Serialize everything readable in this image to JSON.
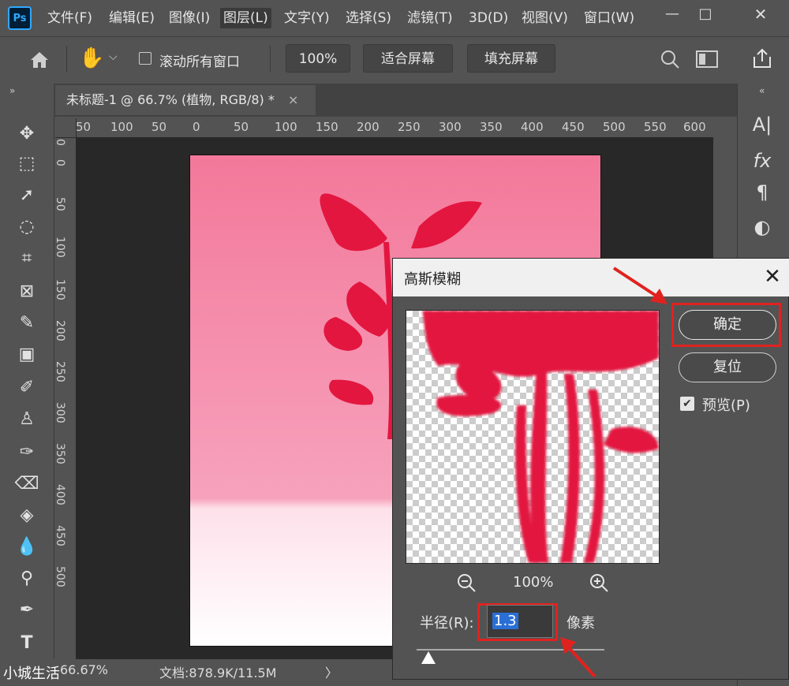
{
  "app": {
    "logo_text": "Ps"
  },
  "menu": [
    "文件(F)",
    "编辑(E)",
    "图像(I)",
    "图层(L)",
    "文字(Y)",
    "选择(S)",
    "滤镜(T)",
    "3D(D)",
    "视图(V)",
    "窗口(W)"
  ],
  "window_controls": {
    "minimize": "—",
    "maximize": "□",
    "close": "✕"
  },
  "options_bar": {
    "scroll_all_label": "滚动所有窗口",
    "zoom_value": "100%",
    "fit_screen_label": "适合屏幕",
    "fill_screen_label": "填充屏幕"
  },
  "document_tab": {
    "title": "未标题-1 @ 66.7% (植物, RGB/8) *",
    "close": "×"
  },
  "ruler": {
    "horizontal_ticks": [
      "50",
      "100",
      "50",
      "0",
      "50",
      "100",
      "150",
      "200",
      "250",
      "300",
      "350",
      "400",
      "450",
      "500",
      "550",
      "600"
    ],
    "vertical_ticks": [
      "0",
      "0",
      "50",
      "100",
      "150",
      "200",
      "250",
      "300",
      "350",
      "400",
      "450",
      "500"
    ]
  },
  "status_bar": {
    "zoom": "66.67%",
    "doc_info": "文档:878.9K/11.5M",
    "chevron": "〉"
  },
  "watermark": "小城生活",
  "dialog": {
    "title": "高斯模糊",
    "close": "✕",
    "ok_label": "确定",
    "reset_label": "复位",
    "preview_label": "预览(P)",
    "preview_checked": true,
    "zoom_value": "100%",
    "radius_label": "半径(R):",
    "radius_value": "1.3",
    "unit_label": "像素"
  },
  "colors": {
    "highlight_box": "#e0221f",
    "plant": "#e3163f",
    "canvas_top": "#f3789a"
  },
  "icons": [
    "home-icon",
    "hand-icon",
    "search-icon",
    "screen-mode-icon",
    "share-icon",
    "zoom-out-icon",
    "zoom-in-icon"
  ]
}
